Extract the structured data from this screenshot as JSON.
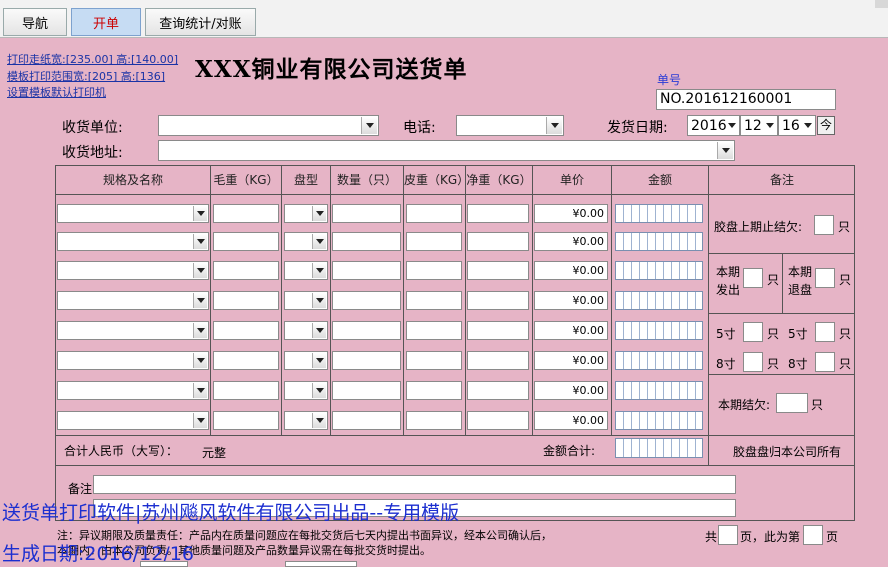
{
  "tabs": [
    {
      "label": "导航"
    },
    {
      "label": "开单"
    },
    {
      "label": "查询统计/对账"
    }
  ],
  "links": {
    "paper_size": "打印走纸宽:[235.00] 高:[140.00]",
    "print_range": "模板打印范围宽:[205] 高:[136]",
    "default_printer": "设置模板默认打印机"
  },
  "title": "XXX铜业有限公司送货单",
  "order": {
    "label": "单号",
    "value": "NO.201612160001"
  },
  "form": {
    "receiver_label": "收货单位:",
    "phone_label": "电话:",
    "ship_date_label": "发货日期:",
    "year": "2016",
    "month": "12",
    "day": "16",
    "today_button": "今",
    "address_label": "收货地址:"
  },
  "table": {
    "headers": [
      "规格及名称",
      "毛重（KG）",
      "盘型",
      "数量（只）",
      "皮重（KG）",
      "净重（KG）",
      "单价",
      "金额",
      "备注"
    ],
    "rows": [
      {
        "price": "¥0.00"
      },
      {
        "price": "¥0.00"
      },
      {
        "price": "¥0.00"
      },
      {
        "price": "¥0.00"
      },
      {
        "price": "¥0.00"
      },
      {
        "price": "¥0.00"
      },
      {
        "price": "¥0.00"
      },
      {
        "price": "¥0.00"
      }
    ]
  },
  "remarks": {
    "prev_balance": "胶盘上期止结欠:",
    "unit": "只",
    "issued_1": "本期",
    "issued_2": "发出",
    "returned_1": "本期",
    "returned_2": "退盘",
    "size5": "5寸",
    "size8": "8寸",
    "balance": "本期结欠:",
    "ownership": "胶盘盘归本公司所有"
  },
  "totals": {
    "rmb_label": "合计人民币（大写）：",
    "rmb_value": "元整",
    "amount_label": "金额合计:"
  },
  "note_label": "备注:",
  "overlay": {
    "line1": "送货单打印软件|苏州飚风软件有限公司出品--专用模版",
    "line2": "生成日期:2016/12/16"
  },
  "footer": {
    "notice_1": "注：异议期限及质量责任：产品内在质量问题应在每批交货后七天内提出书面异议，经本公司确认后，",
    "notice_2": "本期内：由本公司负责。其他质量问题及产品数量异议需在每批交货时提出。",
    "total_label": "共",
    "pages_label": "页，此为第",
    "page_label": "页"
  }
}
